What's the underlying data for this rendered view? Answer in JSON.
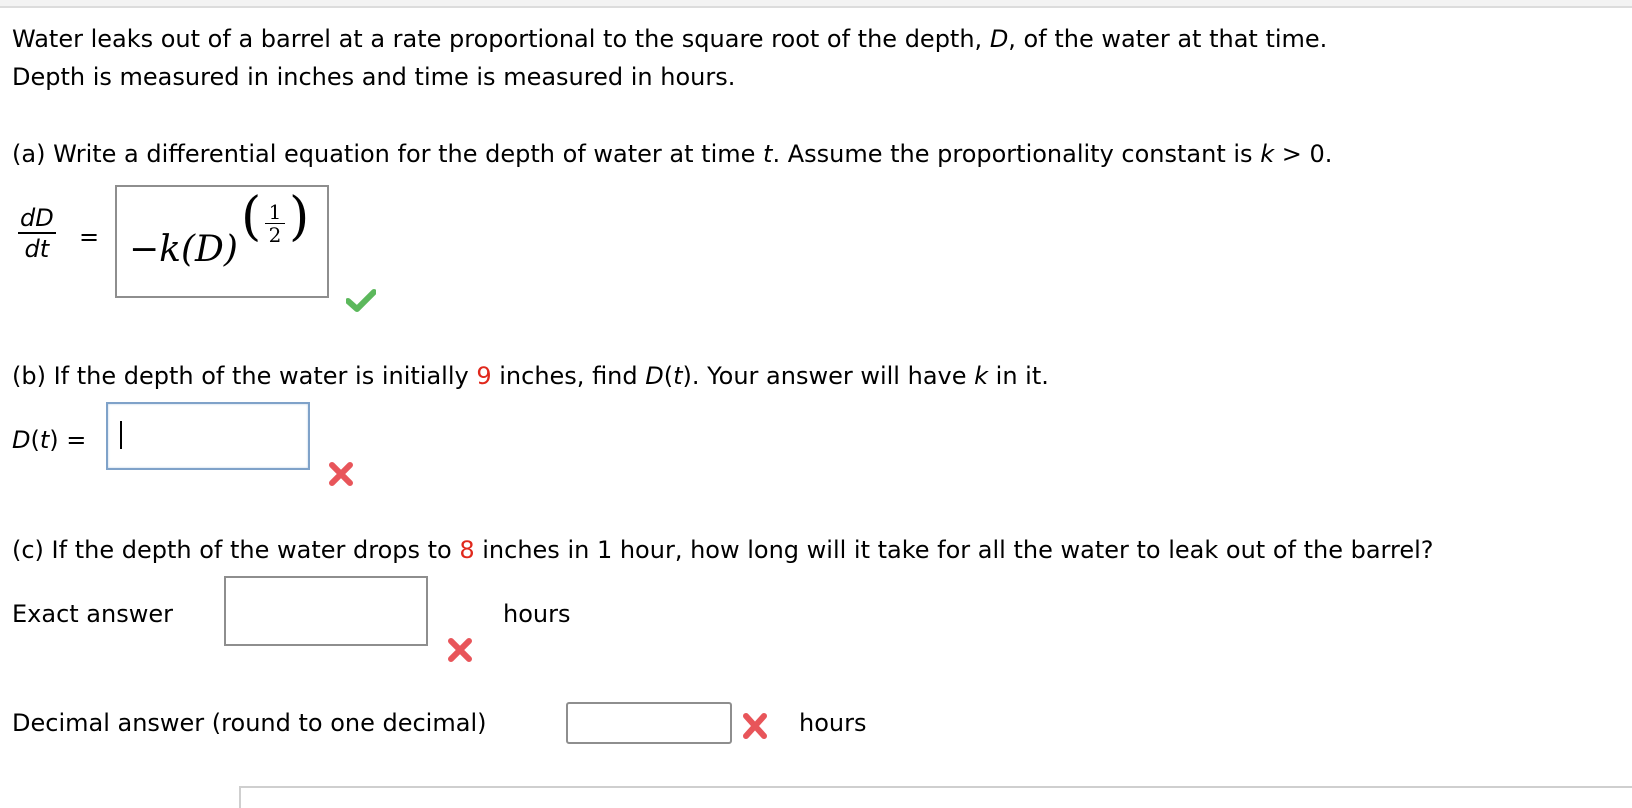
{
  "intro": {
    "line1_a": "Water leaks out of a barrel at a rate proportional to the square root of the depth, ",
    "line1_var": "D",
    "line1_b": ", of the water at that time.",
    "line2": "Depth is measured in inches and time is measured in hours."
  },
  "part_a": {
    "prompt_a": "(a) Write a differential equation for the depth of water at time ",
    "prompt_var_t": "t",
    "prompt_b": ". Assume the proportionality constant is ",
    "prompt_var_k": "k",
    "prompt_c": " > 0.",
    "lhs_num": "dD",
    "lhs_den": "dt",
    "equals": "=",
    "answer_main": "−k(D)",
    "answer_exp_num": "1",
    "answer_exp_den": "2",
    "status": "correct",
    "status_icon": "check-icon",
    "status_color": "#5cb85c"
  },
  "part_b": {
    "prompt_a": "(b) If the depth of the water is initially ",
    "initial_depth": "9",
    "prompt_b": " inches, find ",
    "prompt_func": "D",
    "prompt_c": "(",
    "prompt_var_t": "t",
    "prompt_d": "). Your answer will have ",
    "prompt_var_k": "k",
    "prompt_e": " in it.",
    "label_func": "D",
    "label_open": "(",
    "label_var": "t",
    "label_close": ") =",
    "answer_value": "",
    "status": "incorrect",
    "status_icon": "x-icon",
    "status_color": "#e8555a"
  },
  "part_c": {
    "prompt_a": "(c) If the depth of the water drops to ",
    "depth_value": "8",
    "prompt_b": " inches in 1 hour, how long will it take for all the water to leak out of the barrel?",
    "exact": {
      "label": "Exact answer",
      "value": "",
      "unit": "hours",
      "status": "incorrect"
    },
    "decimal": {
      "label": "Decimal answer (round to one decimal)",
      "value": "",
      "unit": "hours",
      "status": "incorrect"
    }
  },
  "colors": {
    "highlight_number": "#e0281c",
    "correct": "#5cb85c",
    "incorrect": "#e8555a",
    "active_input_border": "#7fa2c9"
  }
}
